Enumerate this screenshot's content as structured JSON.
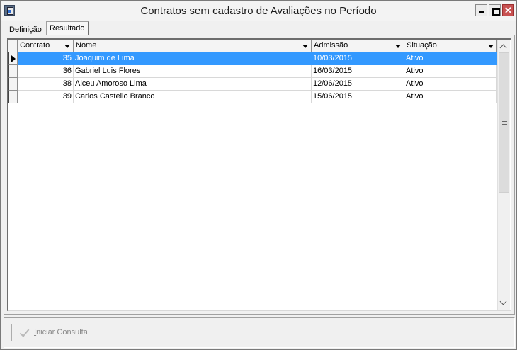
{
  "window": {
    "title": "Contratos sem cadastro de Avaliações no Período",
    "icon": "report-app-icon",
    "controls": {
      "close_glyph": "✕"
    }
  },
  "tabs": [
    {
      "label": "Definição",
      "active": false
    },
    {
      "label": "Resultado",
      "active": true
    }
  ],
  "grid": {
    "columns": [
      {
        "label": "Contrato"
      },
      {
        "label": "Nome"
      },
      {
        "label": "Admissão"
      },
      {
        "label": "Situação"
      }
    ],
    "rows": [
      {
        "contrato": "35",
        "nome": "Joaquim de Lima",
        "admissao": "10/03/2015",
        "situacao": "Ativo",
        "selected": true
      },
      {
        "contrato": "36",
        "nome": "Gabriel Luis Flores",
        "admissao": "16/03/2015",
        "situacao": "Ativo",
        "selected": false
      },
      {
        "contrato": "38",
        "nome": "Alceu Amoroso Lima",
        "admissao": "12/06/2015",
        "situacao": "Ativo",
        "selected": false
      },
      {
        "contrato": "39",
        "nome": "Carlos Castello Branco",
        "admissao": "15/06/2015",
        "situacao": "Ativo",
        "selected": false
      }
    ]
  },
  "footer": {
    "consulta_button": {
      "mnemonic": "I",
      "rest": "niciar Consulta",
      "enabled": false
    }
  },
  "colors": {
    "selection": "#3399ff",
    "close_button": "#c75050",
    "disabled_text": "#8a8a8a"
  }
}
